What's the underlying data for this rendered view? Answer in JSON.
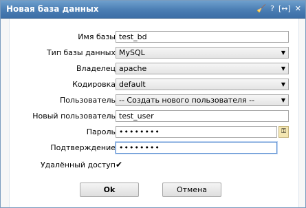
{
  "window": {
    "title": "Новая база данных"
  },
  "toolbar": {
    "icons": [
      "broom-icon",
      "help-icon",
      "maximize-icon",
      "close-icon"
    ],
    "glyphs": [
      "🧹",
      "?",
      "[↔]",
      "✕"
    ]
  },
  "form": {
    "db_name": {
      "label": "Имя базы",
      "value": "test_bd"
    },
    "db_type": {
      "label": "Тип базы данных",
      "value": "MySQL"
    },
    "owner": {
      "label": "Владелец",
      "value": "apache"
    },
    "encoding": {
      "label": "Кодировка",
      "value": "default"
    },
    "user": {
      "label": "Пользователь",
      "value": "-- Создать нового пользователя --"
    },
    "new_user": {
      "label": "Новый пользователь",
      "value": "test_user"
    },
    "password": {
      "label": "Пароль",
      "value": "••••••••"
    },
    "confirm": {
      "label": "Подтверждение",
      "value": "••••••••"
    },
    "remote_access": {
      "label": "Удалённый доступ",
      "checked": true
    }
  },
  "buttons": {
    "ok": "Ok",
    "cancel": "Отмена"
  }
}
